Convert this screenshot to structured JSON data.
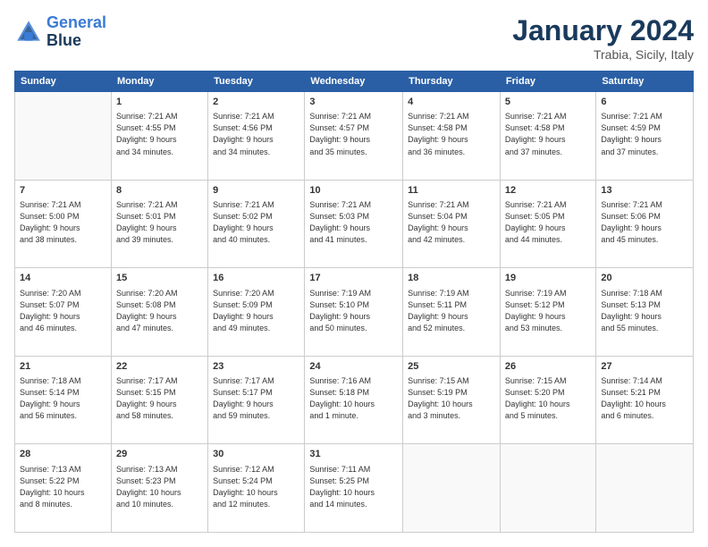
{
  "logo": {
    "line1": "General",
    "line2": "Blue"
  },
  "title": "January 2024",
  "subtitle": "Trabia, Sicily, Italy",
  "days_header": [
    "Sunday",
    "Monday",
    "Tuesday",
    "Wednesday",
    "Thursday",
    "Friday",
    "Saturday"
  ],
  "weeks": [
    [
      {
        "day": "",
        "info": ""
      },
      {
        "day": "1",
        "info": "Sunrise: 7:21 AM\nSunset: 4:55 PM\nDaylight: 9 hours\nand 34 minutes."
      },
      {
        "day": "2",
        "info": "Sunrise: 7:21 AM\nSunset: 4:56 PM\nDaylight: 9 hours\nand 34 minutes."
      },
      {
        "day": "3",
        "info": "Sunrise: 7:21 AM\nSunset: 4:57 PM\nDaylight: 9 hours\nand 35 minutes."
      },
      {
        "day": "4",
        "info": "Sunrise: 7:21 AM\nSunset: 4:58 PM\nDaylight: 9 hours\nand 36 minutes."
      },
      {
        "day": "5",
        "info": "Sunrise: 7:21 AM\nSunset: 4:58 PM\nDaylight: 9 hours\nand 37 minutes."
      },
      {
        "day": "6",
        "info": "Sunrise: 7:21 AM\nSunset: 4:59 PM\nDaylight: 9 hours\nand 37 minutes."
      }
    ],
    [
      {
        "day": "7",
        "info": "Sunrise: 7:21 AM\nSunset: 5:00 PM\nDaylight: 9 hours\nand 38 minutes."
      },
      {
        "day": "8",
        "info": "Sunrise: 7:21 AM\nSunset: 5:01 PM\nDaylight: 9 hours\nand 39 minutes."
      },
      {
        "day": "9",
        "info": "Sunrise: 7:21 AM\nSunset: 5:02 PM\nDaylight: 9 hours\nand 40 minutes."
      },
      {
        "day": "10",
        "info": "Sunrise: 7:21 AM\nSunset: 5:03 PM\nDaylight: 9 hours\nand 41 minutes."
      },
      {
        "day": "11",
        "info": "Sunrise: 7:21 AM\nSunset: 5:04 PM\nDaylight: 9 hours\nand 42 minutes."
      },
      {
        "day": "12",
        "info": "Sunrise: 7:21 AM\nSunset: 5:05 PM\nDaylight: 9 hours\nand 44 minutes."
      },
      {
        "day": "13",
        "info": "Sunrise: 7:21 AM\nSunset: 5:06 PM\nDaylight: 9 hours\nand 45 minutes."
      }
    ],
    [
      {
        "day": "14",
        "info": "Sunrise: 7:20 AM\nSunset: 5:07 PM\nDaylight: 9 hours\nand 46 minutes."
      },
      {
        "day": "15",
        "info": "Sunrise: 7:20 AM\nSunset: 5:08 PM\nDaylight: 9 hours\nand 47 minutes."
      },
      {
        "day": "16",
        "info": "Sunrise: 7:20 AM\nSunset: 5:09 PM\nDaylight: 9 hours\nand 49 minutes."
      },
      {
        "day": "17",
        "info": "Sunrise: 7:19 AM\nSunset: 5:10 PM\nDaylight: 9 hours\nand 50 minutes."
      },
      {
        "day": "18",
        "info": "Sunrise: 7:19 AM\nSunset: 5:11 PM\nDaylight: 9 hours\nand 52 minutes."
      },
      {
        "day": "19",
        "info": "Sunrise: 7:19 AM\nSunset: 5:12 PM\nDaylight: 9 hours\nand 53 minutes."
      },
      {
        "day": "20",
        "info": "Sunrise: 7:18 AM\nSunset: 5:13 PM\nDaylight: 9 hours\nand 55 minutes."
      }
    ],
    [
      {
        "day": "21",
        "info": "Sunrise: 7:18 AM\nSunset: 5:14 PM\nDaylight: 9 hours\nand 56 minutes."
      },
      {
        "day": "22",
        "info": "Sunrise: 7:17 AM\nSunset: 5:15 PM\nDaylight: 9 hours\nand 58 minutes."
      },
      {
        "day": "23",
        "info": "Sunrise: 7:17 AM\nSunset: 5:17 PM\nDaylight: 9 hours\nand 59 minutes."
      },
      {
        "day": "24",
        "info": "Sunrise: 7:16 AM\nSunset: 5:18 PM\nDaylight: 10 hours\nand 1 minute."
      },
      {
        "day": "25",
        "info": "Sunrise: 7:15 AM\nSunset: 5:19 PM\nDaylight: 10 hours\nand 3 minutes."
      },
      {
        "day": "26",
        "info": "Sunrise: 7:15 AM\nSunset: 5:20 PM\nDaylight: 10 hours\nand 5 minutes."
      },
      {
        "day": "27",
        "info": "Sunrise: 7:14 AM\nSunset: 5:21 PM\nDaylight: 10 hours\nand 6 minutes."
      }
    ],
    [
      {
        "day": "28",
        "info": "Sunrise: 7:13 AM\nSunset: 5:22 PM\nDaylight: 10 hours\nand 8 minutes."
      },
      {
        "day": "29",
        "info": "Sunrise: 7:13 AM\nSunset: 5:23 PM\nDaylight: 10 hours\nand 10 minutes."
      },
      {
        "day": "30",
        "info": "Sunrise: 7:12 AM\nSunset: 5:24 PM\nDaylight: 10 hours\nand 12 minutes."
      },
      {
        "day": "31",
        "info": "Sunrise: 7:11 AM\nSunset: 5:25 PM\nDaylight: 10 hours\nand 14 minutes."
      },
      {
        "day": "",
        "info": ""
      },
      {
        "day": "",
        "info": ""
      },
      {
        "day": "",
        "info": ""
      }
    ]
  ]
}
